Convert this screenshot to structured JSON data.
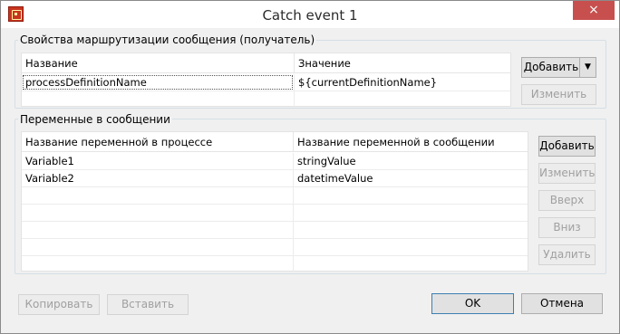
{
  "window": {
    "title": "Catch event 1",
    "close_glyph": "×"
  },
  "routing": {
    "group_label": "Свойства маршрутизации сообщения (получатель)",
    "columns": [
      "Название",
      "Значение"
    ],
    "rows": [
      {
        "name": "processDefinitionName",
        "value": "${currentDefinitionName}"
      }
    ],
    "add_label": "Добавить",
    "add_arrow_glyph": "▼",
    "edit_label": "Изменить"
  },
  "variables": {
    "group_label": "Переменные в сообщении",
    "columns": [
      "Название переменной в процессе",
      "Название переменной в сообщении"
    ],
    "rows": [
      {
        "process_var": "Variable1",
        "message_var": "stringValue"
      },
      {
        "process_var": "Variable2",
        "message_var": "datetimeValue"
      }
    ],
    "add_label": "Добавить",
    "edit_label": "Изменить",
    "up_label": "Вверх",
    "down_label": "Вниз",
    "delete_label": "Удалить"
  },
  "footer": {
    "copy_label": "Копировать",
    "paste_label": "Вставить",
    "ok_label": "OK",
    "cancel_label": "Отмена"
  }
}
